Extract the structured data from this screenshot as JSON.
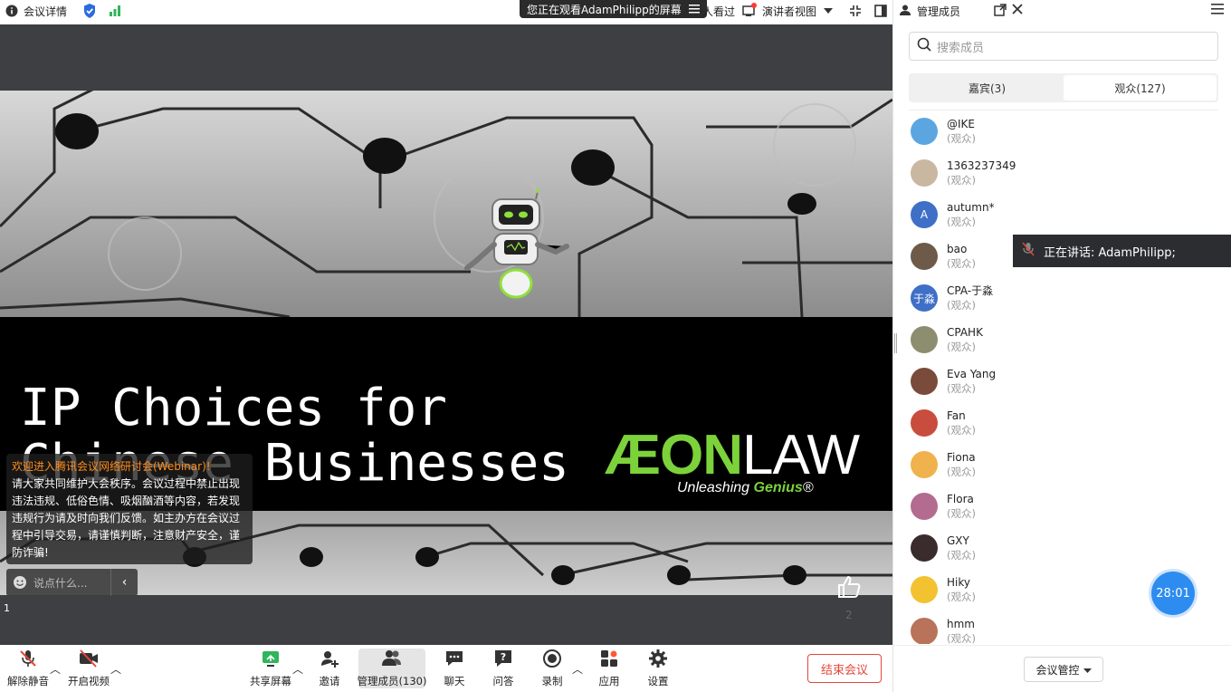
{
  "topbar": {
    "meeting_info": "会议详情",
    "share_banner": "您正在观看AdamPhilipp的屏幕",
    "viewers": "人看过",
    "presenter_view": "演讲者视图"
  },
  "slide": {
    "title_line1": "IP Choices for",
    "title_line2": "Chinese Businesses",
    "logo_text_green": "ÆON",
    "logo_text_white": "LAW",
    "logo_tag_plain": "Unleashing ",
    "logo_tag_bold": "Genius",
    "logo_tag_mark": "®",
    "page_number": "1",
    "like_count": "2"
  },
  "notice": {
    "heading": "欢迎进入腾讯会议网络研讨会(Webinar)!",
    "body": "请大家共同维护大会秩序。会议过程中禁止出现违法违规、低俗色情、吸烟酗酒等内容，若发现违规行为请及时向我们反馈。如主办方在会议过程中引导交易，请谨慎判断，注意财产安全，谨防诈骗!"
  },
  "chat": {
    "placeholder": "说点什么..."
  },
  "toolbar": {
    "mute": "解除静音",
    "video": "开启视频",
    "share": "共享屏幕",
    "invite": "邀请",
    "members": "管理成员(130)",
    "chat": "聊天",
    "qa": "问答",
    "record": "录制",
    "apps": "应用",
    "settings": "设置",
    "end": "结束会议"
  },
  "panel": {
    "title": "管理成员",
    "search_placeholder": "搜索成员",
    "tab_guests": "嘉宾(3)",
    "tab_audience": "观众(127)",
    "members": [
      {
        "name": "@IKE",
        "role": "(观众)",
        "avatar": "",
        "color": "#5ba6e0"
      },
      {
        "name": "1363237349",
        "role": "(观众)",
        "avatar": "",
        "color": "#c9b7a2"
      },
      {
        "name": "autumn*",
        "role": "(观众)",
        "avatar": "A",
        "color": "#3f6fc7"
      },
      {
        "name": "bao",
        "role": "(观众)",
        "avatar": "",
        "color": "#6d5a48"
      },
      {
        "name": "CPA-于淼",
        "role": "(观众)",
        "avatar": "于淼",
        "color": "#3f6fc7"
      },
      {
        "name": "CPAHK",
        "role": "(观众)",
        "avatar": "",
        "color": "#8d8d70"
      },
      {
        "name": "Eva Yang",
        "role": "(观众)",
        "avatar": "",
        "color": "#7a4b3a"
      },
      {
        "name": "Fan",
        "role": "(观众)",
        "avatar": "",
        "color": "#c94d3c"
      },
      {
        "name": "Fiona",
        "role": "(观众)",
        "avatar": "",
        "color": "#f0b24c"
      },
      {
        "name": "Flora",
        "role": "(观众)",
        "avatar": "",
        "color": "#b36b8f"
      },
      {
        "name": "GXY",
        "role": "(观众)",
        "avatar": "",
        "color": "#3a2c2c"
      },
      {
        "name": "Hiky",
        "role": "(观众)",
        "avatar": "",
        "color": "#f2c230"
      },
      {
        "name": "hmm",
        "role": "(观众)",
        "avatar": "",
        "color": "#b8735a"
      }
    ],
    "control_button": "会议管控",
    "timer": "28:01",
    "speaking": "正在讲话:  AdamPhilipp;"
  }
}
